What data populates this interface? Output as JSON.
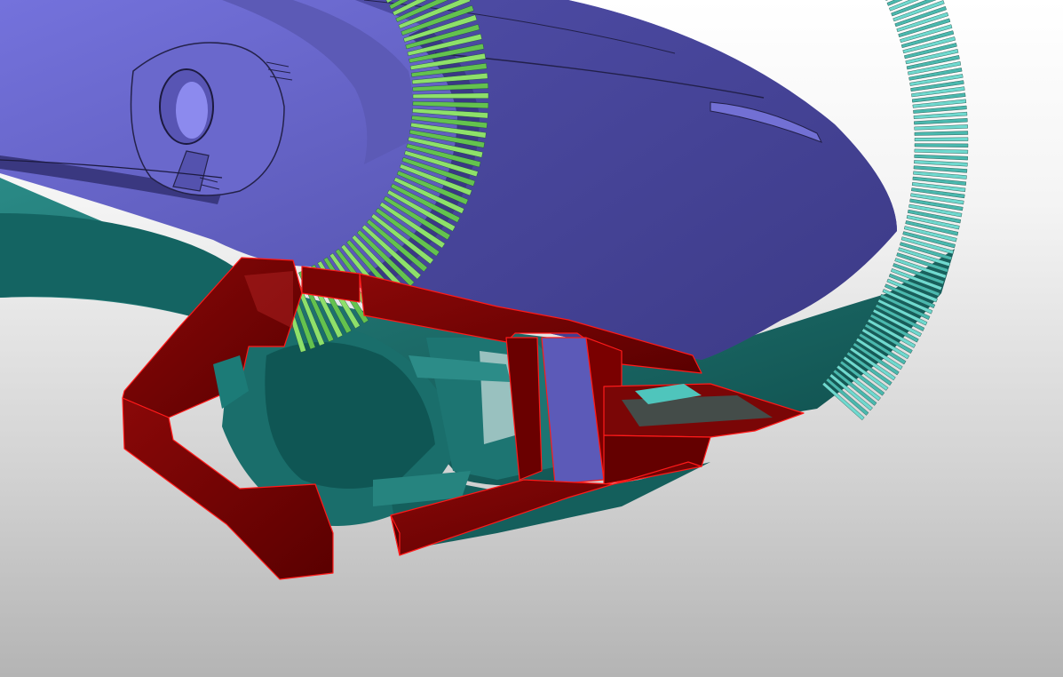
{
  "viewport": {
    "background": {
      "top": "#ffffff",
      "bottom": "#b4b4b4"
    }
  },
  "model": {
    "colors": {
      "upper_surface_light": "#7472dc",
      "upper_surface_mid": "#5c5ab8",
      "upper_surface_dark": "#3c3a86",
      "inner_ring_green": "#8ee06a",
      "outer_teeth_cyan": "#6fd9cf",
      "lower_body_teal": "#1f7370",
      "lower_body_dark": "#0d4a48",
      "section_cut_red": "#7a0000",
      "section_cut_edge": "#ff1a1a",
      "inner_cavity_blue": "#4a4aa8"
    },
    "features": {
      "inner_tooth_count": 60,
      "outer_tooth_count": 150
    }
  }
}
